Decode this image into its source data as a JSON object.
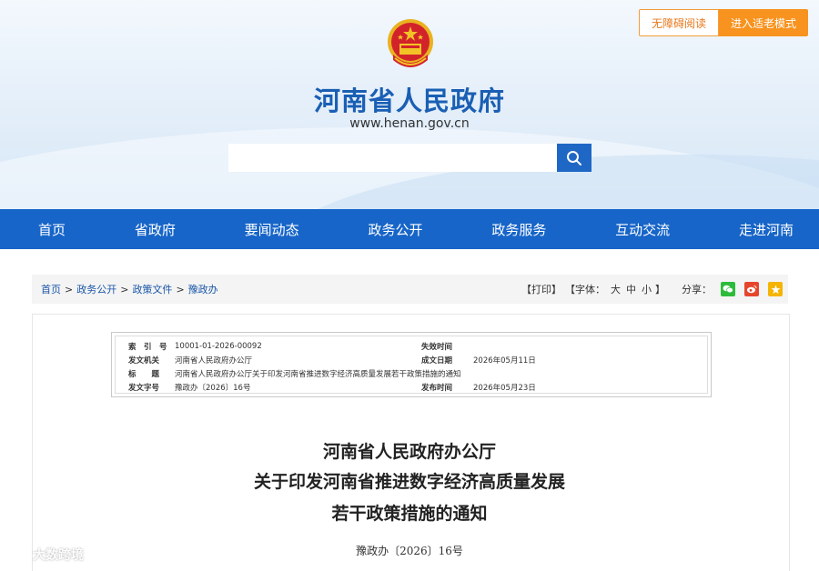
{
  "header": {
    "accessible_label": "无障碍阅读",
    "elder_mode_label": "进入适老模式",
    "site_title": "河南省人民政府",
    "site_url": "www.henan.gov.cn",
    "search_placeholder": ""
  },
  "nav": {
    "items": [
      {
        "label": "首页"
      },
      {
        "label": "省政府"
      },
      {
        "label": "要闻动态"
      },
      {
        "label": "政务公开"
      },
      {
        "label": "政务服务"
      },
      {
        "label": "互动交流"
      },
      {
        "label": "走进河南"
      }
    ]
  },
  "breadcrumb": {
    "items": [
      "首页",
      "政务公开",
      "政策文件",
      "豫政办"
    ],
    "separator": ">"
  },
  "tools": {
    "print": "【打印】",
    "font_open": "【字体：",
    "font_large": "大",
    "font_medium": "中",
    "font_small": "小",
    "font_close": "】",
    "share_label": "分享："
  },
  "meta": {
    "index_label": "索　引　号",
    "index_value": "10001-01-2026-00092",
    "effect_label": "失效时间",
    "effect_value": "",
    "issuer_label": "发文机关",
    "issuer_value": "河南省人民政府办公厅",
    "date_label": "成文日期",
    "date_value": "2026年05月11日",
    "subject_label": "标　　题",
    "subject_value": "河南省人民政府办公厅关于印发河南省推进数字经济高质量发展若干政策措施的通知",
    "docno_label": "发文字号",
    "docno_value": "豫政办〔2026〕16号",
    "publish_label": "发布时间",
    "publish_value": "2026年05月23日"
  },
  "document": {
    "title_line1": "河南省人民政府办公厅",
    "title_line2": "关于印发河南省推进数字经济高质量发展",
    "title_line3": "若干政策措施的通知",
    "doc_number": "豫政办〔2026〕16号"
  },
  "watermark": {
    "text": "大数跨境"
  },
  "colors": {
    "nav_bg": "#1765c8",
    "title_blue": "#1a5fb4",
    "elder_orange": "#f7931e",
    "wechat_green": "#2dbb3b",
    "weibo_red": "#e6462c",
    "star_yellow": "#f5b400"
  }
}
